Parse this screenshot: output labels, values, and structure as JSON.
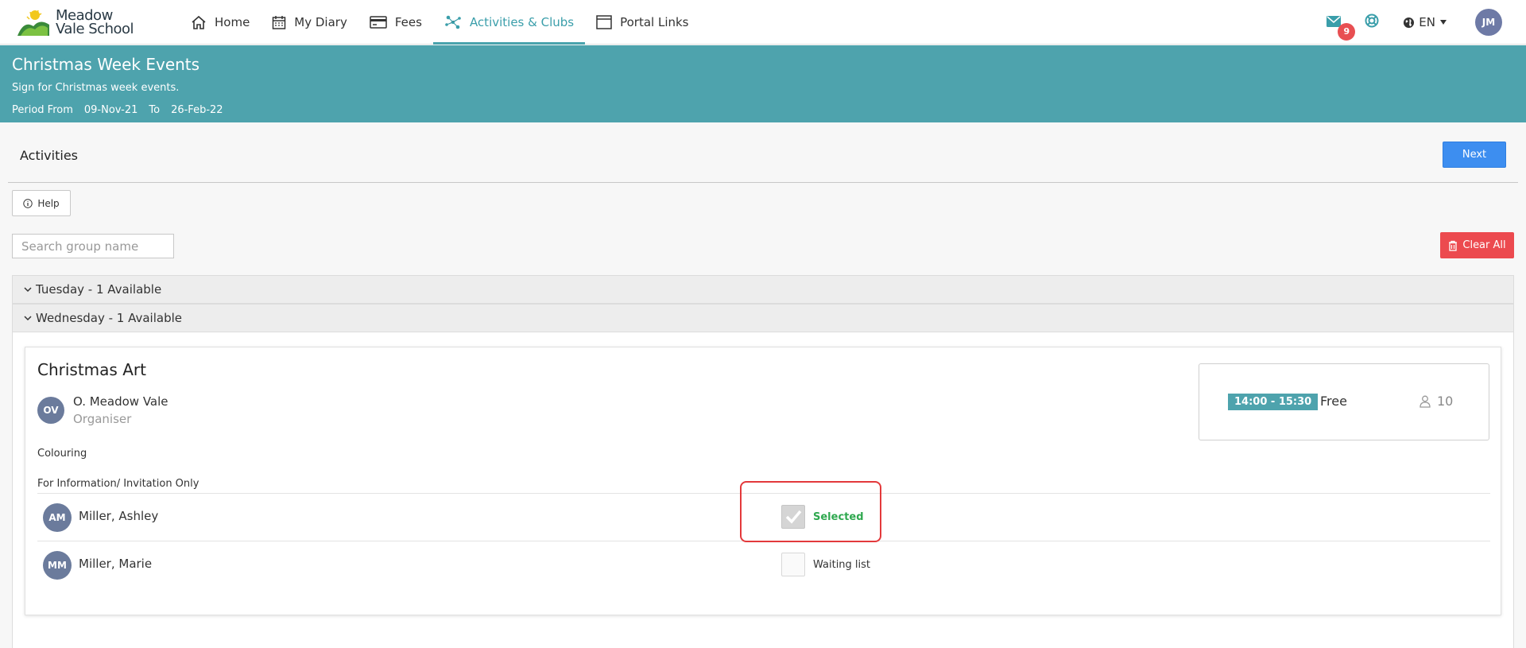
{
  "brand": {
    "line1": "Meadow",
    "line2": "Vale School"
  },
  "nav": {
    "items": [
      {
        "label": "Home",
        "icon": "home-icon"
      },
      {
        "label": "My Diary",
        "icon": "calendar-icon"
      },
      {
        "label": "Fees",
        "icon": "credit-card-icon"
      },
      {
        "label": "Activities & Clubs",
        "icon": "network-icon"
      },
      {
        "label": "Portal Links",
        "icon": "window-icon"
      }
    ],
    "active": "Activities & Clubs",
    "mail_count": "9",
    "language": "EN",
    "user_initials": "JM",
    "accent": "#4ea3ad"
  },
  "banner": {
    "title": "Christmas Week Events",
    "subtitle": "Sign for Christmas week events.",
    "period_label": "Period From",
    "from": "09-Nov-21",
    "to_label": "To",
    "to": "26-Feb-22"
  },
  "toolbar": {
    "title": "Activities",
    "next_label": "Next",
    "help_label": "Help",
    "search_placeholder": "Search group name",
    "clear_label": "Clear All"
  },
  "groups": [
    {
      "label": "Tuesday - 1 Available"
    },
    {
      "label": "Wednesday - 1 Available"
    }
  ],
  "activity": {
    "title": "Christmas Art",
    "organiser_initials": "OV",
    "organiser_name": "O. Meadow Vale",
    "organiser_role": "Organiser",
    "description": "Colouring",
    "note": "For Information/ Invitation Only",
    "time": "14:00 - 15:30",
    "price": "Free",
    "capacity": "10",
    "children": [
      {
        "initials": "AM",
        "name": "Miller, Ashley",
        "status": "Selected",
        "checked": true
      },
      {
        "initials": "MM",
        "name": "Miller, Marie",
        "status": "Waiting list",
        "checked": false
      }
    ]
  }
}
